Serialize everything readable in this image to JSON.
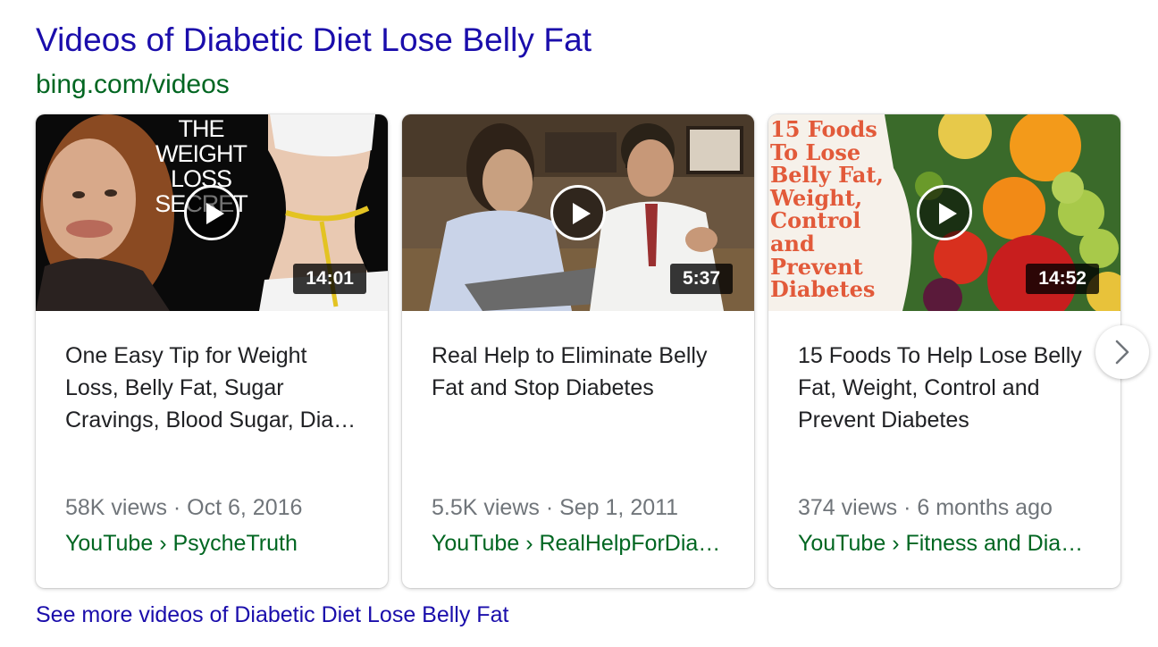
{
  "header": {
    "title": "Videos of Diabetic Diet Lose Belly Fat",
    "url": "bing.com/videos"
  },
  "videos": [
    {
      "thumbnail_text": "THE\nWEIGHT\nLOSS\nSECRET",
      "duration": "14:01",
      "title": "One Easy Tip for Weight Loss, Belly Fat, Sugar Cravings, Blood Sugar, Dia…",
      "meta": "58K views · Oct 6, 2016",
      "source": "YouTube › PsycheTruth"
    },
    {
      "thumbnail_text": "",
      "duration": "5:37",
      "title": "Real Help to Eliminate Belly Fat and Stop Diabetes",
      "meta": "5.5K views · Sep 1, 2011",
      "source": "YouTube › RealHelpForDia…"
    },
    {
      "thumbnail_text": "15 Foods\nTo Lose\nBelly Fat,\nWeight,\nControl\nand\nPrevent\nDiabetes",
      "duration": "14:52",
      "title": "15 Foods To Help Lose Belly Fat, Weight, Control and Prevent Diabetes",
      "meta": "374 views · 6 months ago",
      "source": "YouTube › Fitness and Dia…"
    }
  ],
  "see_more": "See more videos of Diabetic Diet Lose Belly Fat",
  "icons": {
    "play": "play-icon",
    "next": "chevron-right-icon"
  },
  "colors": {
    "title_link": "#1a0dab",
    "url_green": "#006621",
    "meta_gray": "#70757a",
    "text": "#202124"
  }
}
